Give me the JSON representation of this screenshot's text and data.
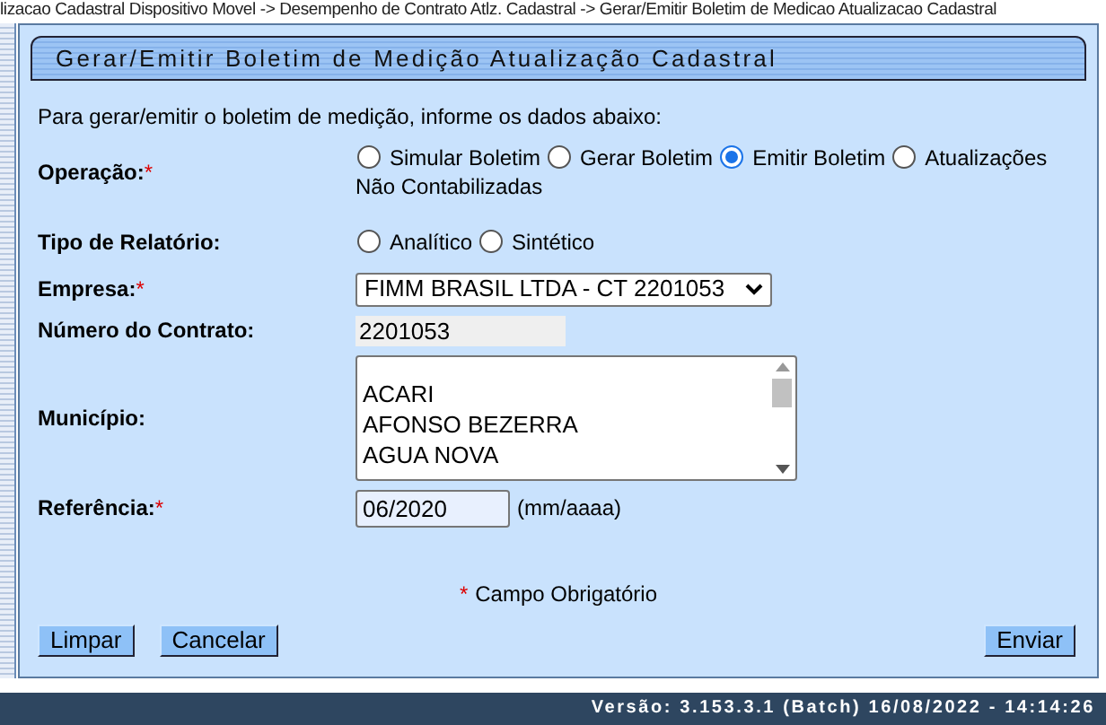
{
  "breadcrumb": "lizacao Cadastral Dispositivo Movel -> Desempenho de Contrato Atlz. Cadastral -> Gerar/Emitir Boletim de Medicao Atualizacao Cadastral",
  "title": "Gerar/Emitir Boletim de Medição Atualização Cadastral",
  "intro": "Para gerar/emitir o boletim de medição, informe os dados abaixo:",
  "fields": [
    {
      "kind": "radio",
      "label": "Operação:",
      "required_mark": "*",
      "options": [
        {
          "label": "Simular Boletim",
          "selected": false
        },
        {
          "label": "Gerar Boletim",
          "selected": false
        },
        {
          "label": "Emitir Boletim",
          "selected": true
        },
        {
          "label": "Atualizações",
          "label_continued": "Não Contabilizadas",
          "selected": false
        }
      ]
    },
    {
      "kind": "radio",
      "label": "Tipo de Relatório:",
      "options": [
        {
          "label": "Analítico",
          "selected": false
        },
        {
          "label": "Sintético",
          "selected": false
        }
      ]
    },
    {
      "kind": "select",
      "label": "Empresa:",
      "required_mark": "*",
      "value": "FIMM BRASIL LTDA - CT 2201053"
    },
    {
      "kind": "readonly",
      "label": "Número do Contrato:",
      "value": "2201053"
    },
    {
      "kind": "list",
      "label": "Município:",
      "items": [
        "ACARI",
        "AFONSO BEZERRA",
        "AGUA NOVA"
      ]
    },
    {
      "kind": "text",
      "label": "Referência:",
      "required_mark": "*",
      "value": "06/2020",
      "hint": "(mm/aaaa)"
    }
  ],
  "required_note_mark": "*",
  "required_note": "Campo Obrigatório",
  "buttons_left": [
    "Limpar",
    "Cancelar"
  ],
  "buttons_right": [
    "Enviar"
  ],
  "version": "Versão: 3.153.3.1 (Batch) 16/08/2022 - 14:14:26"
}
